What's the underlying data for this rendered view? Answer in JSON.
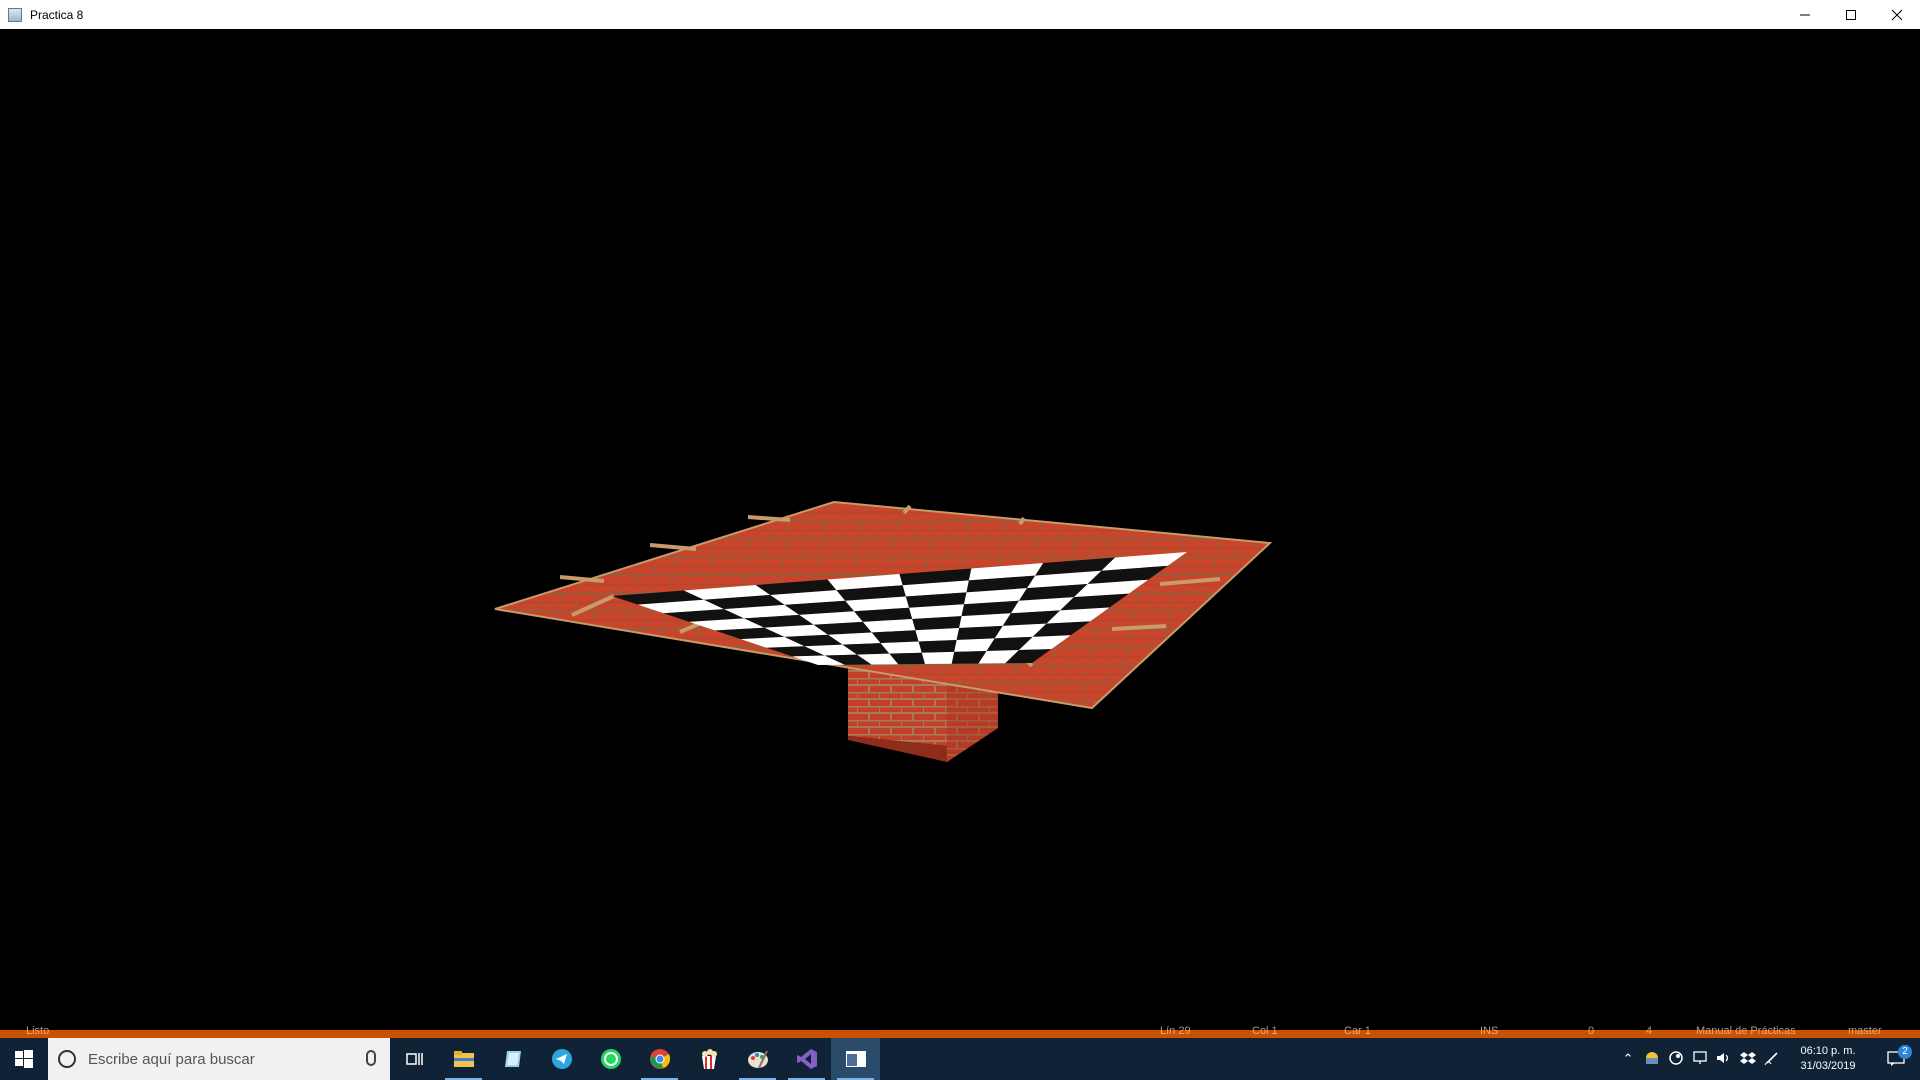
{
  "window": {
    "title": "Practica 8",
    "controls": {
      "minimize": "—",
      "maximize": "☐",
      "close": "✕"
    }
  },
  "scene": {
    "object": "chessboard-table",
    "board_squares": 8,
    "colors": {
      "brick": "#c8442a",
      "mortar": "#b88a5a",
      "light_square": "#ffffff",
      "dark_square": "#111111"
    }
  },
  "vs_status_bar": {
    "ready": "Listo",
    "line": "Lín 29",
    "col": "Col 1",
    "car": "Car 1",
    "ins": "INS",
    "errors": "0",
    "changes": "4",
    "repo": "Manual de Prácticas",
    "branch": "master"
  },
  "taskbar": {
    "search_placeholder": "Escribe aquí para buscar",
    "apps": [
      "task-view",
      "file-explorer",
      "notes",
      "telegram",
      "whatsapp",
      "chrome",
      "popcorn-time",
      "paint",
      "visual-studio",
      "opengl-window"
    ],
    "clock_time": "06:10 p. m.",
    "clock_date": "31/03/2019",
    "notifications_count": "2"
  }
}
